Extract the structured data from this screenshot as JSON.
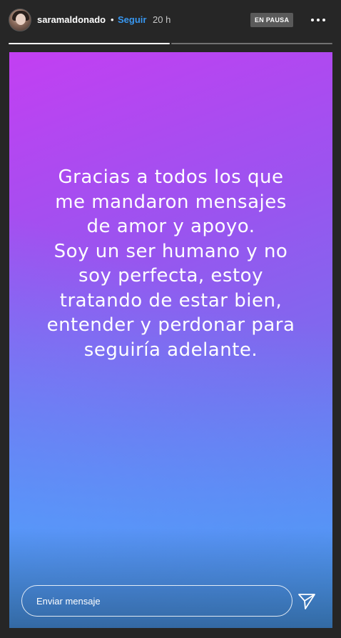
{
  "header": {
    "username": "saramaldonado",
    "separator": "•",
    "follow_label": "Seguir",
    "time": "20 h",
    "paused_label": "EN PAUSA",
    "more_icon": "more-horizontal-icon"
  },
  "progress": {
    "segments": [
      {
        "fill": 1.0
      },
      {
        "fill": 0.0
      }
    ]
  },
  "story": {
    "lines": [
      "Gracias a todos los que",
      "me mandaron mensajes",
      "de amor y apoyo.",
      "Soy un ser humano y no",
      "soy perfecta, estoy",
      "tratando de estar bien,",
      "entender y perdonar para",
      "seguiría adelante."
    ],
    "gradient_colors": [
      "#c33ff2",
      "#7c6bee",
      "#4ea0f7"
    ]
  },
  "reply": {
    "placeholder": "Enviar mensaje",
    "value": "",
    "send_icon": "send-icon"
  }
}
